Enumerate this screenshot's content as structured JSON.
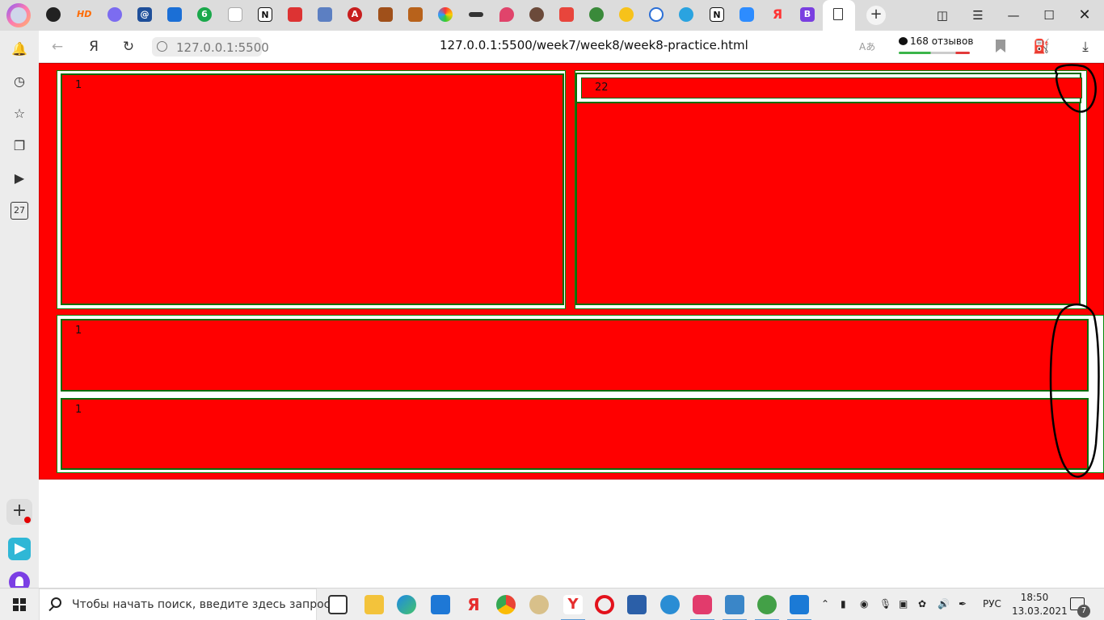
{
  "browser": {
    "origin_chip": "127.0.0.1:5500",
    "url": "127.0.0.1:5500/week7/week8/week8-practice.html",
    "reviews_label": "168 отзывов",
    "translate_glyph": "Aあ",
    "yandex_glyph": "Я",
    "new_tab": "+",
    "calendar_day": "27",
    "tab_icons": [
      "github-icon",
      "hd-icon",
      "kinopoisk-icon",
      "at-icon",
      "mail-icon",
      "number6-icon",
      "doc-icon",
      "notion-icon",
      "puzzle-icon",
      "mailbox-icon",
      "a-star-icon",
      "blocks-icon",
      "blocks2-icon",
      "color-wheel-icon",
      "sushi-icon",
      "drop-icon",
      "ball-icon",
      "home-up-icon",
      "bird-icon",
      "smiley-icon",
      "compass-icon",
      "telegram-icon",
      "notion2-icon",
      "zoom-icon",
      "yandex-icon",
      "b-icon"
    ]
  },
  "content": {
    "box_top_left": "1",
    "box_inner_top_right": "22",
    "box_row2": "1",
    "box_row3": "1"
  },
  "taskbar": {
    "search_placeholder": "Чтобы начать поиск, введите здесь запрос",
    "lang": "РУС",
    "time": "18:50",
    "date": "13.03.2021",
    "notif_count": "7"
  },
  "colors": {
    "page_bg_red": "#ff0000",
    "box_border_green": "#0a6d0a",
    "annotation_ink": "#000000"
  }
}
